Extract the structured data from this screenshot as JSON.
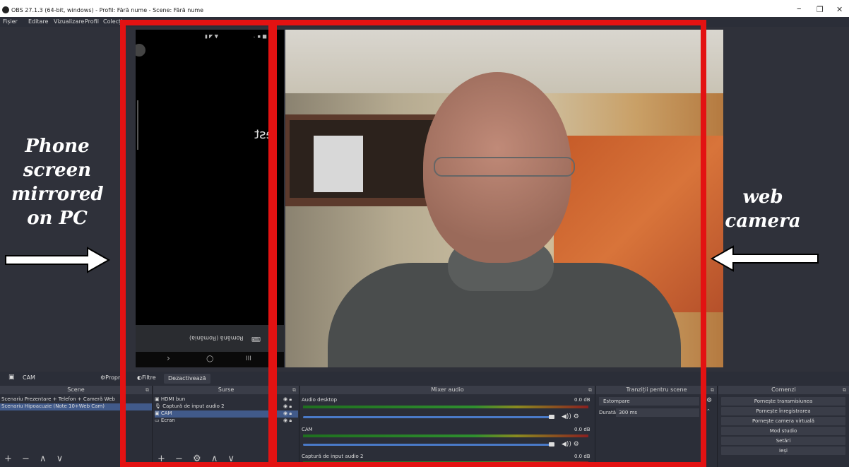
{
  "window": {
    "title": "OBS 27.1.3 (64-bit, windows) - Profil: Fără nume - Scene: Fără nume",
    "minimize": "–",
    "maximize": "❐",
    "close": "✕"
  },
  "menu": [
    "Fișier",
    "Editare",
    "Vizualizare",
    "Profil",
    "Colecție"
  ],
  "phone_screen": {
    "text": "est",
    "keyboard_language": "Română (România)",
    "nav": [
      "›",
      "○",
      "III"
    ]
  },
  "annotations": {
    "phone": [
      "Phone",
      "screen",
      "mirrored",
      "on PC"
    ],
    "camera": [
      "web",
      "camera"
    ]
  },
  "toolbar": {
    "source_name": "CAM",
    "properties": "Propr",
    "filters": "Filtre",
    "deactivate": "Dezactivează"
  },
  "scenes": {
    "header": "Scene",
    "items": [
      "Scenariu Prezentare + Telefon + Cameră Web",
      "Scenariu Hipoacuzie (Note 10+Web Cam)"
    ]
  },
  "sources": {
    "header": "Surse",
    "items": [
      "HDMI bun",
      "Captură de input audio 2",
      "CAM",
      "Ecran"
    ]
  },
  "mixer": {
    "header": "Mixer audio",
    "channels": [
      {
        "name": "Audio desktop",
        "level": "0.0 dB"
      },
      {
        "name": "CAM",
        "level": "0.0 dB"
      },
      {
        "name": "Captură de input audio 2",
        "level": "0.0 dB"
      }
    ]
  },
  "transitions": {
    "header": "Tranziții pentru scene",
    "type": "Estompare",
    "duration_label": "Durată",
    "duration_value": "300 ms"
  },
  "controls": {
    "header": "Comenzi",
    "buttons": [
      "Pornește transmisiunea",
      "Pornește înregistrarea",
      "Pornește camera virtuală",
      "Mod studio",
      "Setări",
      "Ieși"
    ]
  }
}
